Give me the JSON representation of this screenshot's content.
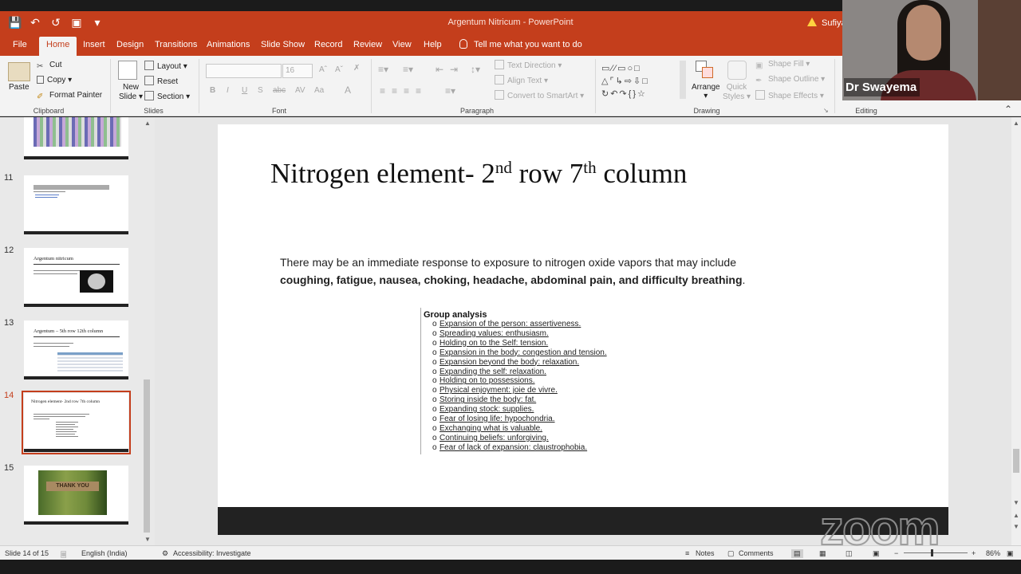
{
  "window": {
    "title": "Argentum Nitricum  -  PowerPoint",
    "user": "Sufiya"
  },
  "tabs": [
    "File",
    "Home",
    "Insert",
    "Design",
    "Transitions",
    "Animations",
    "Slide Show",
    "Record",
    "Review",
    "View",
    "Help"
  ],
  "active_tab": "Home",
  "tell_me": "Tell me what you want to do",
  "ribbon": {
    "clipboard": {
      "paste": "Paste",
      "cut": "Cut",
      "copy": "Copy",
      "format_painter": "Format Painter",
      "label": "Clipboard"
    },
    "slides": {
      "new_slide_1": "New",
      "new_slide_2": "Slide",
      "layout": "Layout",
      "reset": "Reset",
      "section": "Section",
      "label": "Slides"
    },
    "font": {
      "font_size": "16",
      "bold": "B",
      "italic": "I",
      "underline": "U",
      "strike": "S",
      "shadow": "abc",
      "spacing": "AV",
      "case": "Aa",
      "color": "A",
      "label": "Font"
    },
    "paragraph": {
      "text_direction": "Text Direction",
      "align_text": "Align Text",
      "convert": "Convert to SmartArt",
      "label": "Paragraph"
    },
    "drawing": {
      "arrange": "Arrange",
      "quick_styles_1": "Quick",
      "quick_styles_2": "Styles",
      "shape_fill": "Shape Fill",
      "shape_outline": "Shape Outline",
      "shape_effects": "Shape Effects",
      "label": "Drawing"
    },
    "editing": {
      "label": "Editing"
    }
  },
  "thumbnails": [
    {
      "num": "11",
      "title": ""
    },
    {
      "num": "12",
      "title": "Argentum nitricum"
    },
    {
      "num": "13",
      "title": "Argentum – 5th row 12th column"
    },
    {
      "num": "14",
      "title": "Nitrogen element- 2nd row 7th column"
    },
    {
      "num": "15",
      "title": "THANK YOU"
    }
  ],
  "slide": {
    "title_part1": "Nitrogen element- 2",
    "title_sup1": "nd",
    "title_part2": " row 7",
    "title_sup2": "th",
    "title_part3": " column",
    "body_intro": "There may be an immediate response to exposure to nitrogen oxide vapors that may include ",
    "body_bold": "coughing, fatigue, nausea, choking, headache, abdominal pain, and difficulty breathing",
    "body_end": ".",
    "group_title": "Group analysis",
    "group_items": [
      "Expansion of the person: assertiveness.",
      "Spreading values: enthusiasm.",
      "Holding on to the Self: tension.",
      "Expansion in the body: congestion and tension.",
      "Expansion beyond the body: relaxation.",
      "Expanding the self: relaxation.",
      "Holding on to possessions.",
      "Physical enjoyment: joie de vivre.",
      "Storing inside the body: fat.",
      "Expanding stock: supplies.",
      "Fear of losing life: hypochondria.",
      "Exchanging what is valuable.",
      "Continuing beliefs: unforgiving.",
      "Fear of lack of expansion: claustrophobia."
    ]
  },
  "status": {
    "slide_info": "Slide 14 of 15",
    "language": "English (India)",
    "accessibility": "Accessibility: Investigate",
    "notes": "Notes",
    "comments": "Comments",
    "zoom": "86%"
  },
  "webcam": {
    "name": "Dr Swayema"
  },
  "watermark": "zoom",
  "colors": {
    "accent": "#c43e1c",
    "ribbon_bg": "#f3f3f3",
    "footer_bar": "#222222"
  }
}
